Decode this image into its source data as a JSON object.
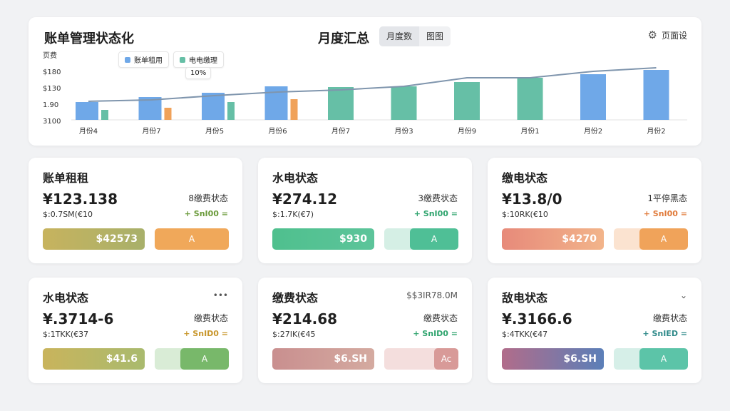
{
  "header": {
    "app_title": "账单管理状态化",
    "summary_title": "月度汇总",
    "view_tabs": [
      "月度数",
      "图图"
    ],
    "settings_label": "页面设"
  },
  "chart_data": {
    "type": "bar",
    "categories": [
      "月份4",
      "月份7",
      "月份5",
      "月份6",
      "月份7",
      "月份3",
      "月份9",
      "月份1",
      "月份2",
      "月份2"
    ],
    "ytick_labels": [
      "页费",
      "$180",
      "$130",
      "1.90",
      "3100"
    ],
    "legend": [
      "账单租用",
      "电电缴理"
    ],
    "tooltip": "10%",
    "series": [
      {
        "name": "账单租用",
        "color": "#6fa8e8",
        "values": [
          25,
          32,
          38,
          47,
          null,
          null,
          null,
          null,
          null,
          null
        ]
      },
      {
        "name": "电电缴理",
        "color": "#66bfa6",
        "values": [
          14,
          null,
          25,
          null,
          46,
          47,
          53,
          59,
          null,
          null
        ]
      },
      {
        "color": "#f0a25a",
        "values": [
          null,
          17,
          null,
          29,
          null,
          null,
          null,
          null,
          null,
          null
        ]
      },
      {
        "color": "#6fa8e8",
        "values": [
          null,
          null,
          null,
          null,
          null,
          null,
          null,
          null,
          64,
          70
        ]
      }
    ],
    "line": [
      26,
      28,
      34,
      39,
      42,
      47,
      59,
      59,
      68,
      73
    ],
    "ylim": [
      0,
      80
    ]
  },
  "cards": [
    {
      "title": "账单租租",
      "corner": "",
      "amount": "¥123.138",
      "sub": "$:0.7SM(€10",
      "status": "8缴费状态",
      "tag": "+ SnI00 =",
      "tag_color": "#6a9a3a",
      "bar_label": "$42573",
      "bar_gradient": [
        "#c7b35e",
        "#a8b06a"
      ],
      "btn_label": "A",
      "btn_color": "#f0a85a",
      "btn_bg": "#fbe6cf",
      "btn_width": 104
    },
    {
      "title": "水电状态",
      "corner": "",
      "amount": "¥274.12",
      "sub": "$:1.7K(€7)",
      "status": "3缴费状态",
      "tag": "+ SnI00 =",
      "tag_color": "#2fa46e",
      "bar_label": "$930",
      "bar_gradient": [
        "#4fc08e",
        "#5cc49a"
      ],
      "btn_label": "A",
      "btn_color": "#4fbf96",
      "btn_bg": "#d5efe5",
      "btn_width": 68
    },
    {
      "title": "缴电状态",
      "corner": "",
      "amount": "¥13.8/0",
      "sub": "$:10RK(€10",
      "status": "1平停黑态",
      "tag": "+ SnI00 =",
      "tag_color": "#e07a3a",
      "bar_label": "$4270",
      "bar_gradient": [
        "#e78a7a",
        "#f2b48a"
      ],
      "btn_label": "A",
      "btn_color": "#f0a35a",
      "btn_bg": "#fbe3d0",
      "btn_width": 68
    },
    {
      "title": "水电状态",
      "corner": "•••",
      "amount": "¥.3714-6",
      "sub": "$:1TKK(€37",
      "status": "缴费状态",
      "tag": "+ SnID0 =",
      "tag_color": "#c8962a",
      "bar_label": "$41.6",
      "bar_gradient": [
        "#c9b45c",
        "#a9ba6e"
      ],
      "btn_label": "A",
      "btn_color": "#78b86a",
      "btn_bg": "#d9ecd6",
      "btn_width": 68
    },
    {
      "title": "缴费状态",
      "corner": "$$3IR78.0M",
      "amount": "¥214.68",
      "sub": "$:27IK(€45",
      "status": "缴费状态",
      "tag": "+ SnID0 =",
      "tag_color": "#2fa46e",
      "bar_label": "$6.SH",
      "bar_gradient": [
        "#c98f8f",
        "#d4aaa0"
      ],
      "btn_label": "Ac",
      "btn_color": "#d89a98",
      "btn_bg": "#f4dedd",
      "btn_width": 34
    },
    {
      "title": "敌电状态",
      "corner": "⌄",
      "amount": "¥.3166.6",
      "sub": "$:4TKK(€47",
      "status": "缴费状态",
      "tag": "+ SnIED =",
      "tag_color": "#2f8a8a",
      "bar_label": "$6.SH",
      "bar_gradient": [
        "#b16c8a",
        "#5b7fb8"
      ],
      "btn_label": "A",
      "btn_color": "#5cc4a8",
      "btn_bg": "#d6efe8",
      "btn_width": 68
    }
  ],
  "icons": {
    "settings": "gear-icon",
    "more": "more-icon",
    "expand": "chevron-down-icon"
  }
}
